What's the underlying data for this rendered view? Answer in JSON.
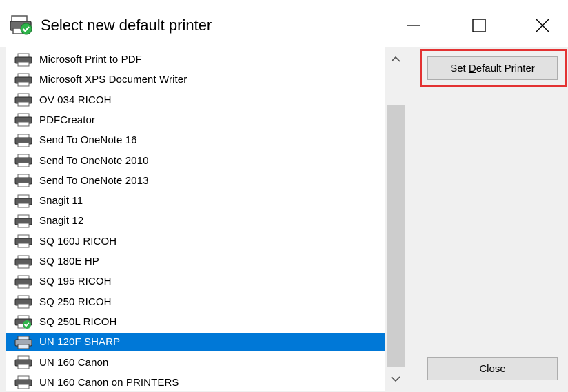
{
  "window": {
    "title": "Select new default printer",
    "controls": {
      "minimize": "minimize",
      "maximize": "maximize",
      "close": "close"
    }
  },
  "printers": [
    {
      "name": "Microsoft Print to PDF",
      "default": false,
      "selected": false
    },
    {
      "name": "Microsoft XPS Document Writer",
      "default": false,
      "selected": false
    },
    {
      "name": "OV 034 RICOH",
      "default": false,
      "selected": false
    },
    {
      "name": "PDFCreator",
      "default": false,
      "selected": false
    },
    {
      "name": "Send To OneNote 16",
      "default": false,
      "selected": false
    },
    {
      "name": "Send To OneNote 2010",
      "default": false,
      "selected": false
    },
    {
      "name": "Send To OneNote 2013",
      "default": false,
      "selected": false
    },
    {
      "name": "Snagit 11",
      "default": false,
      "selected": false
    },
    {
      "name": "Snagit 12",
      "default": false,
      "selected": false
    },
    {
      "name": "SQ 160J RICOH",
      "default": false,
      "selected": false
    },
    {
      "name": "SQ 180E HP",
      "default": false,
      "selected": false
    },
    {
      "name": "SQ 195 RICOH",
      "default": false,
      "selected": false
    },
    {
      "name": "SQ 250 RICOH",
      "default": false,
      "selected": false
    },
    {
      "name": "SQ 250L RICOH",
      "default": true,
      "selected": false
    },
    {
      "name": "UN 120F SHARP",
      "default": false,
      "selected": true
    },
    {
      "name": "UN 160 Canon",
      "default": false,
      "selected": false
    },
    {
      "name": "UN 160 Canon on PRINTERS",
      "default": false,
      "selected": false
    }
  ],
  "buttons": {
    "set_default": {
      "prefix": "Set ",
      "mnemonic": "D",
      "suffix": "efault Printer"
    },
    "close": {
      "prefix": "",
      "mnemonic": "C",
      "suffix": "lose"
    }
  },
  "colors": {
    "selection": "#0078d7",
    "highlight_box": "#e33232",
    "default_check": "#2fb34a"
  }
}
